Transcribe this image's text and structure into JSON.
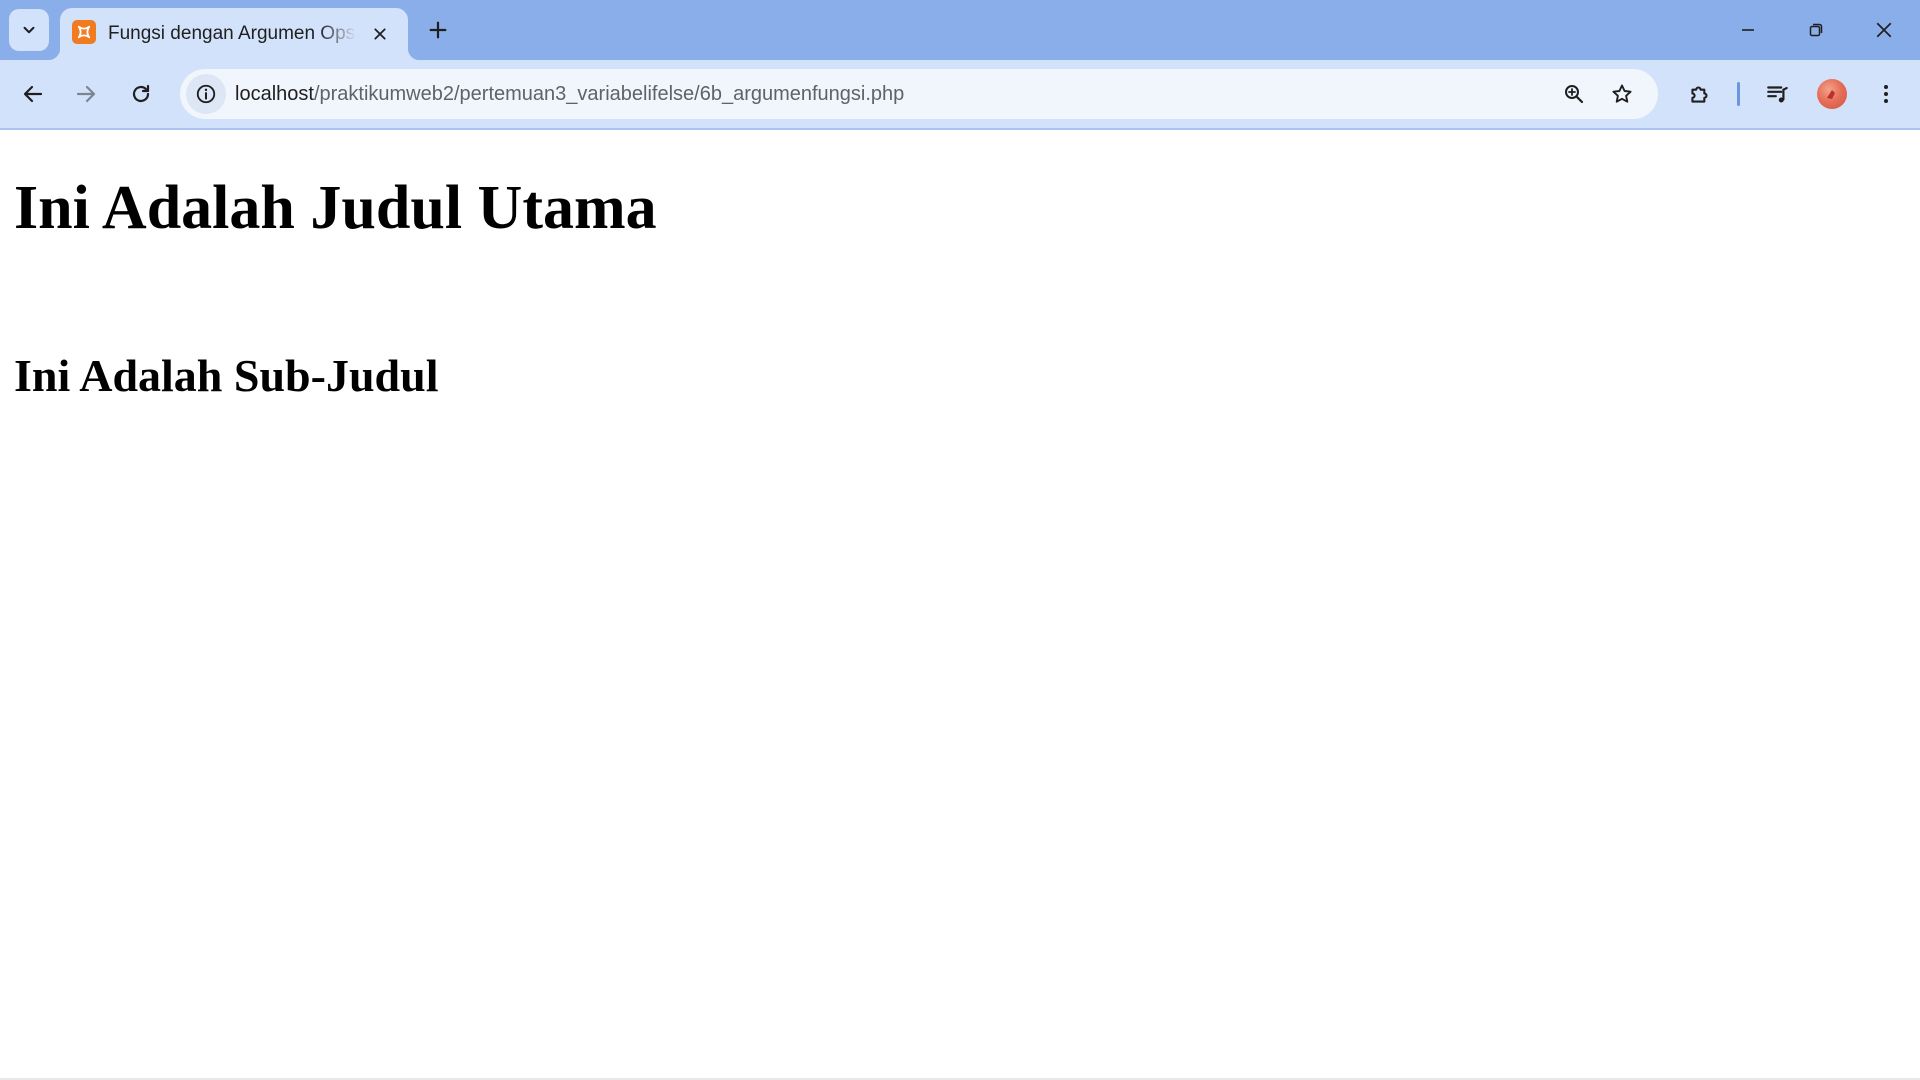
{
  "browser": {
    "tab": {
      "title": "Fungsi dengan Argumen Opsional",
      "favicon": "xampp-icon"
    },
    "address_bar": {
      "host": "localhost",
      "path": "/praktikumweb2/pertemuan3_variabelifelse/6b_argumenfungsi.php"
    },
    "icons": {
      "tab_search": "chevron-down-icon",
      "tab_close": "close-icon",
      "new_tab": "plus-icon",
      "minimize": "minimize-icon",
      "restore": "restore-icon",
      "close_window": "close-icon",
      "back": "arrow-left-icon",
      "forward": "arrow-right-icon",
      "reload": "reload-icon",
      "site_info": "info-icon",
      "zoom": "zoom-icon",
      "bookmark": "star-icon",
      "extensions": "puzzle-icon",
      "media": "playlist-icon",
      "profile": "avatar",
      "menu": "kebab-menu-icon"
    },
    "colors": {
      "tabstrip": "#8aaeea",
      "toolbar": "#d3e2fb",
      "omnibox": "#f1f5fc",
      "favicon": "#f07b20"
    }
  },
  "page": {
    "heading_main": "Ini Adalah Judul Utama",
    "heading_sub": "Ini Adalah Sub-Judul"
  }
}
